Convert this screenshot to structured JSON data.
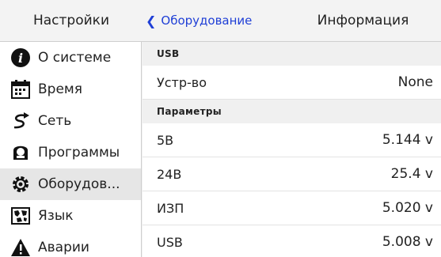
{
  "header": {
    "left_title": "Настройки",
    "back_label": "Оборудование",
    "right_title": "Информация"
  },
  "sidebar": {
    "items": [
      {
        "label": "О системе",
        "icon": "info-icon"
      },
      {
        "label": "Время",
        "icon": "calendar-icon"
      },
      {
        "label": "Сеть",
        "icon": "network-icon"
      },
      {
        "label": "Программы",
        "icon": "apps-icon"
      },
      {
        "label": "Оборудов...",
        "icon": "gear-icon",
        "active": true
      },
      {
        "label": "Язык",
        "icon": "map-icon"
      },
      {
        "label": "Аварии",
        "icon": "warning-icon"
      }
    ]
  },
  "main": {
    "usb_header": "USB",
    "device_label": "Устр-во",
    "device_value": "None",
    "params_header": "Параметры",
    "rows": [
      {
        "label": "5B",
        "value": "5.144 v"
      },
      {
        "label": "24B",
        "value": "25.4 v"
      },
      {
        "label": "ИЗП",
        "value": "5.020 v"
      },
      {
        "label": "USB",
        "value": "5.008 v"
      }
    ]
  },
  "colors": {
    "accent": "#1f3fd6",
    "background": "#f2f2f2",
    "active_item": "#e6e6e6"
  }
}
